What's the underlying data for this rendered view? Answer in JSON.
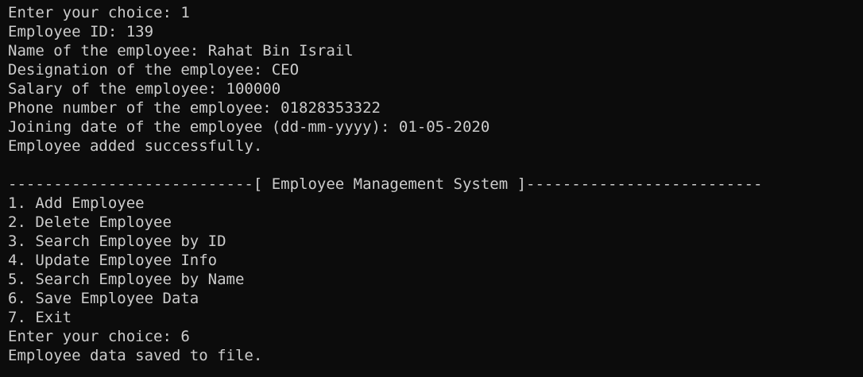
{
  "terminal": {
    "background": "#0c0c0c",
    "foreground": "#cccccc",
    "lines": [
      "Enter your choice: 1",
      "Employee ID: 139",
      "Name of the employee: Rahat Bin Israil",
      "Designation of the employee: CEO",
      "Salary of the employee: 100000",
      "Phone number of the employee: 01828353322",
      "Joining date of the employee (dd-mm-yyyy): 01-05-2020",
      "Employee added successfully.",
      "",
      "---------------------------[ Employee Management System ]--------------------------",
      "1. Add Employee",
      "2. Delete Employee",
      "3. Search Employee by ID",
      "4. Update Employee Info",
      "5. Search Employee by Name",
      "6. Save Employee Data",
      "7. Exit",
      "Enter your choice: 6",
      "Employee data saved to file."
    ]
  }
}
